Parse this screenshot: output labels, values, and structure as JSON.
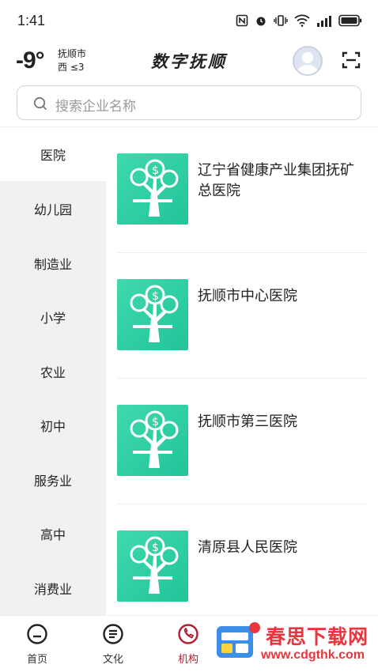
{
  "status_bar": {
    "time": "1:41"
  },
  "header": {
    "temperature": "-9°",
    "city": "抚顺市",
    "wind": "西  ≤3",
    "title": "数字抚顺"
  },
  "search": {
    "placeholder": "搜索企业名称"
  },
  "sidebar": {
    "items": [
      {
        "label": "医院",
        "active": true
      },
      {
        "label": "幼儿园",
        "active": false
      },
      {
        "label": "制造业",
        "active": false
      },
      {
        "label": "小学",
        "active": false
      },
      {
        "label": "农业",
        "active": false
      },
      {
        "label": "初中",
        "active": false
      },
      {
        "label": "服务业",
        "active": false
      },
      {
        "label": "高中",
        "active": false
      },
      {
        "label": "消费业",
        "active": false
      }
    ]
  },
  "organizations": [
    {
      "name": "辽宁省健康产业集团抚矿总医院"
    },
    {
      "name": "抚顺市中心医院"
    },
    {
      "name": "抚顺市第三医院"
    },
    {
      "name": "清原县人民医院"
    }
  ],
  "tabbar": {
    "tabs": [
      {
        "label": "首页",
        "icon": "home-icon"
      },
      {
        "label": "文化",
        "icon": "document-icon"
      },
      {
        "label": "机构",
        "icon": "phone-icon",
        "active": true
      }
    ]
  },
  "watermark": {
    "line1": "春思下载网",
    "line2": "www.cdgthk.com"
  },
  "colors": {
    "accent": "#b01e2f",
    "thumb": "#2fcfa3",
    "sidebar_bg": "#f1f1f1",
    "watermark": "#e8363f"
  }
}
